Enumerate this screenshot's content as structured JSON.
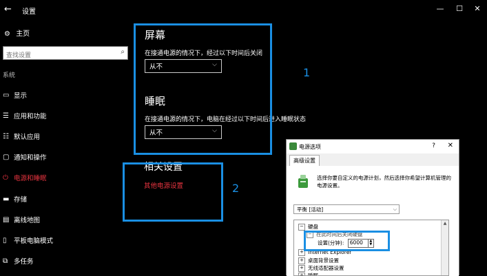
{
  "window": {
    "title": "设置",
    "controls": {
      "minimize": "—",
      "maximize": "☐",
      "close": "✕"
    }
  },
  "sidebar": {
    "home_label": "主页",
    "search_placeholder": "查找设置",
    "section_title": "系统",
    "items": [
      {
        "label": "显示",
        "icon": "monitor-icon"
      },
      {
        "label": "应用和功能",
        "icon": "apps-list-icon"
      },
      {
        "label": "默认应用",
        "icon": "default-apps-icon"
      },
      {
        "label": "通知和操作",
        "icon": "notifications-icon"
      },
      {
        "label": "电源和睡眠",
        "icon": "power-icon",
        "active": true
      },
      {
        "label": "存储",
        "icon": "storage-icon"
      },
      {
        "label": "离线地图",
        "icon": "offline-map-icon"
      },
      {
        "label": "平板电脑模式",
        "icon": "tablet-mode-icon"
      },
      {
        "label": "多任务",
        "icon": "multitask-icon"
      }
    ]
  },
  "main": {
    "screen": {
      "title": "屏幕",
      "description": "在接通电源的情况下，经过以下时间后关闭",
      "value": "从不"
    },
    "sleep": {
      "title": "睡眠",
      "description": "在接通电源的情况下，电脑在经过以下时间后进入睡眠状态",
      "value": "从不"
    },
    "related": {
      "title": "相关设置",
      "link": "其他电源设置"
    }
  },
  "annotations": {
    "box1_label": "1",
    "box2_label": "2",
    "color": "#1a8fe3"
  },
  "dialog": {
    "title": "电源选项",
    "help": "?",
    "close": "✕",
    "tab": "高级设置",
    "description": "选择你要自定义的电源计划，然后选择你希望计算机管理的电源设置。",
    "plan": "平衡 [活动]",
    "tree": {
      "disk": "硬盘",
      "disk_sub": "在此时间后关闭硬盘",
      "setting_label": "设置(分钟):",
      "setting_value": "6000",
      "ie": "Internet Explorer",
      "desktop_bg": "桌面背景设置",
      "wireless": "无线适配器设置",
      "sleep": "睡眠"
    }
  },
  "colors": {
    "accent_red": "#e7343f",
    "background": "#000000",
    "annotation_blue": "#1a8fe3"
  }
}
